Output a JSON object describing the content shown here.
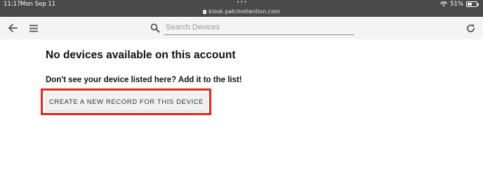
{
  "status_bar": {
    "time": "11:17",
    "date": "Mon Sep 11",
    "url": "kiosk.patchretention.com",
    "battery": "51%",
    "battery_level": 0.51
  },
  "toolbar": {
    "back_icon": "arrow-left-icon",
    "menu_icon": "hamburger-menu-icon",
    "search_icon": "search-icon",
    "refresh_icon": "refresh-icon",
    "search_placeholder": "Search Devices"
  },
  "main": {
    "heading": "No devices available on this account",
    "subheading": "Don't see your device listed here? Add it to the list!",
    "create_button_label": "CREATE A NEW RECORD FOR THIS DEVICE"
  },
  "colors": {
    "highlight": "#e8261a",
    "status_bar_bg": "#4a4a4a",
    "toolbar_bg": "#f4f4f4"
  }
}
